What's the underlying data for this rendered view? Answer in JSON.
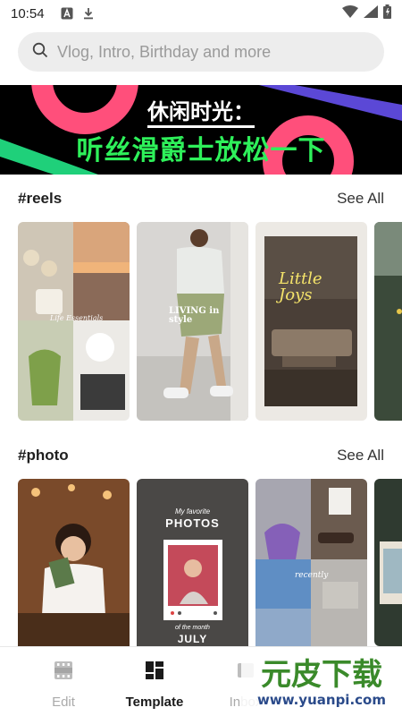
{
  "status_bar": {
    "time": "10:54"
  },
  "search": {
    "placeholder": "Vlog, Intro, Birthday and more"
  },
  "banner": {
    "line1": "休闲时光：",
    "line2": "听丝滑爵士放松一下"
  },
  "sections": [
    {
      "title": "#reels",
      "see_all": "See All"
    },
    {
      "title": "#photo",
      "see_all": "See All"
    }
  ],
  "reels_thumbs": [
    {
      "caption": "Life Essentials"
    },
    {
      "caption": "LIVING in style"
    },
    {
      "caption": "Little Joys"
    }
  ],
  "photo_thumbs": [
    {
      "caption": ""
    },
    {
      "caption_top": "My favorite",
      "caption_main": "PHOTOS",
      "caption_bottom1": "of the month",
      "caption_bottom2": "JULY"
    },
    {
      "caption": "recently"
    }
  ],
  "bottom_nav": [
    {
      "label": "Edit",
      "icon": "film-icon",
      "active": false
    },
    {
      "label": "Template",
      "icon": "template-grid-icon",
      "active": true
    },
    {
      "label": "Inbox",
      "icon": "inbox-icon",
      "active": false
    }
  ],
  "watermark": {
    "text_cn": "元皮下载",
    "url": "www.yuanpi.com"
  },
  "colors": {
    "banner_green": "#2ef05a",
    "banner_pink": "#ff4f7b",
    "banner_purple": "#5b48d6",
    "active_nav": "#1a1a1a",
    "inactive_nav": "#aaaaaa"
  }
}
